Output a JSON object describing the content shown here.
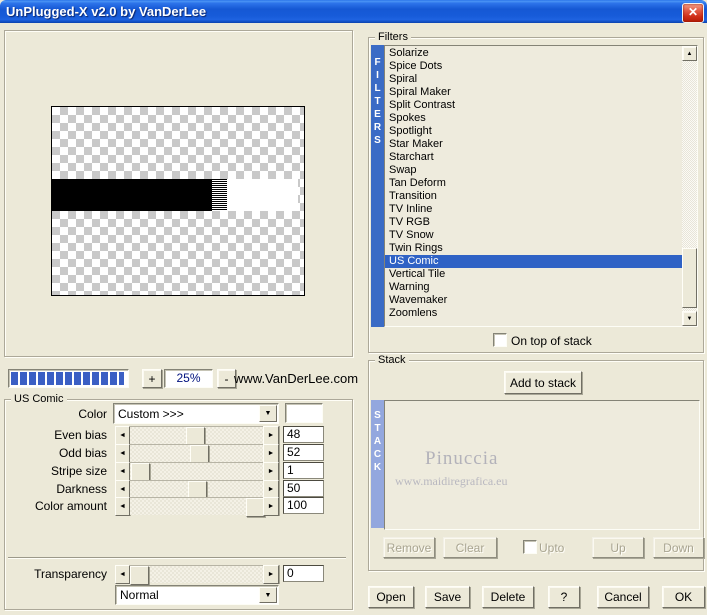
{
  "window": {
    "title": "UnPlugged-X v2.0 by VanDerLee",
    "close_glyph": "✕"
  },
  "branding": {
    "website": "www.VanDerLee.com"
  },
  "preview": {
    "zoom_level": "25%",
    "zoom_in_label": "+",
    "zoom_out_label": "-"
  },
  "filters": {
    "group_label": "Filters",
    "vertical_label": "FILTERS",
    "items": [
      "Solarize",
      "Spice Dots",
      "Spiral",
      "Spiral Maker",
      "Split Contrast",
      "Spokes",
      "Spotlight",
      "Star Maker",
      "Starchart",
      "Swap",
      "Tan Deform",
      "Transition",
      "TV Inline",
      "TV RGB",
      "TV Snow",
      "Twin Rings",
      "US Comic",
      "Vertical Tile",
      "Warning",
      "Wavemaker",
      "Zoomlens"
    ],
    "selected": "US Comic",
    "on_top_label": "On top of stack"
  },
  "filter_settings": {
    "group_label": "US Comic",
    "color": {
      "label": "Color",
      "value": "Custom >>>",
      "swatch": "#ffffff"
    },
    "sliders": [
      {
        "label": "Even bias",
        "value": 48,
        "min": 0,
        "max": 100
      },
      {
        "label": "Odd bias",
        "value": 52,
        "min": 0,
        "max": 100
      },
      {
        "label": "Stripe size",
        "value": 1,
        "min": 0,
        "max": 100
      },
      {
        "label": "Darkness",
        "value": 50,
        "min": 0,
        "max": 100
      },
      {
        "label": "Color amount",
        "value": 100,
        "min": 0,
        "max": 100
      }
    ],
    "transparency": {
      "label": "Transparency",
      "value": 0,
      "min": 0,
      "max": 100
    },
    "blend_mode": "Normal"
  },
  "stack": {
    "group_label": "Stack",
    "vertical_label": "STACK",
    "add_button": "Add to stack",
    "watermark_line1": "Pinuccia",
    "watermark_line2": "www.maidiregrafica.eu",
    "remove_button": "Remove",
    "clear_button": "Clear",
    "upto_label": "Upto",
    "up_button": "Up",
    "down_button": "Down"
  },
  "footer": {
    "open": "Open",
    "save": "Save",
    "delete": "Delete",
    "help": "?",
    "cancel": "Cancel",
    "ok": "OK"
  },
  "colors": {
    "accent_blue": "#2f62c5",
    "filters_bar_blue": "#3a6bc5",
    "stack_bar_blue": "#93a7de",
    "progress_segment_blue": "#3b5fc4",
    "dialog_background": "#ece9d8"
  }
}
